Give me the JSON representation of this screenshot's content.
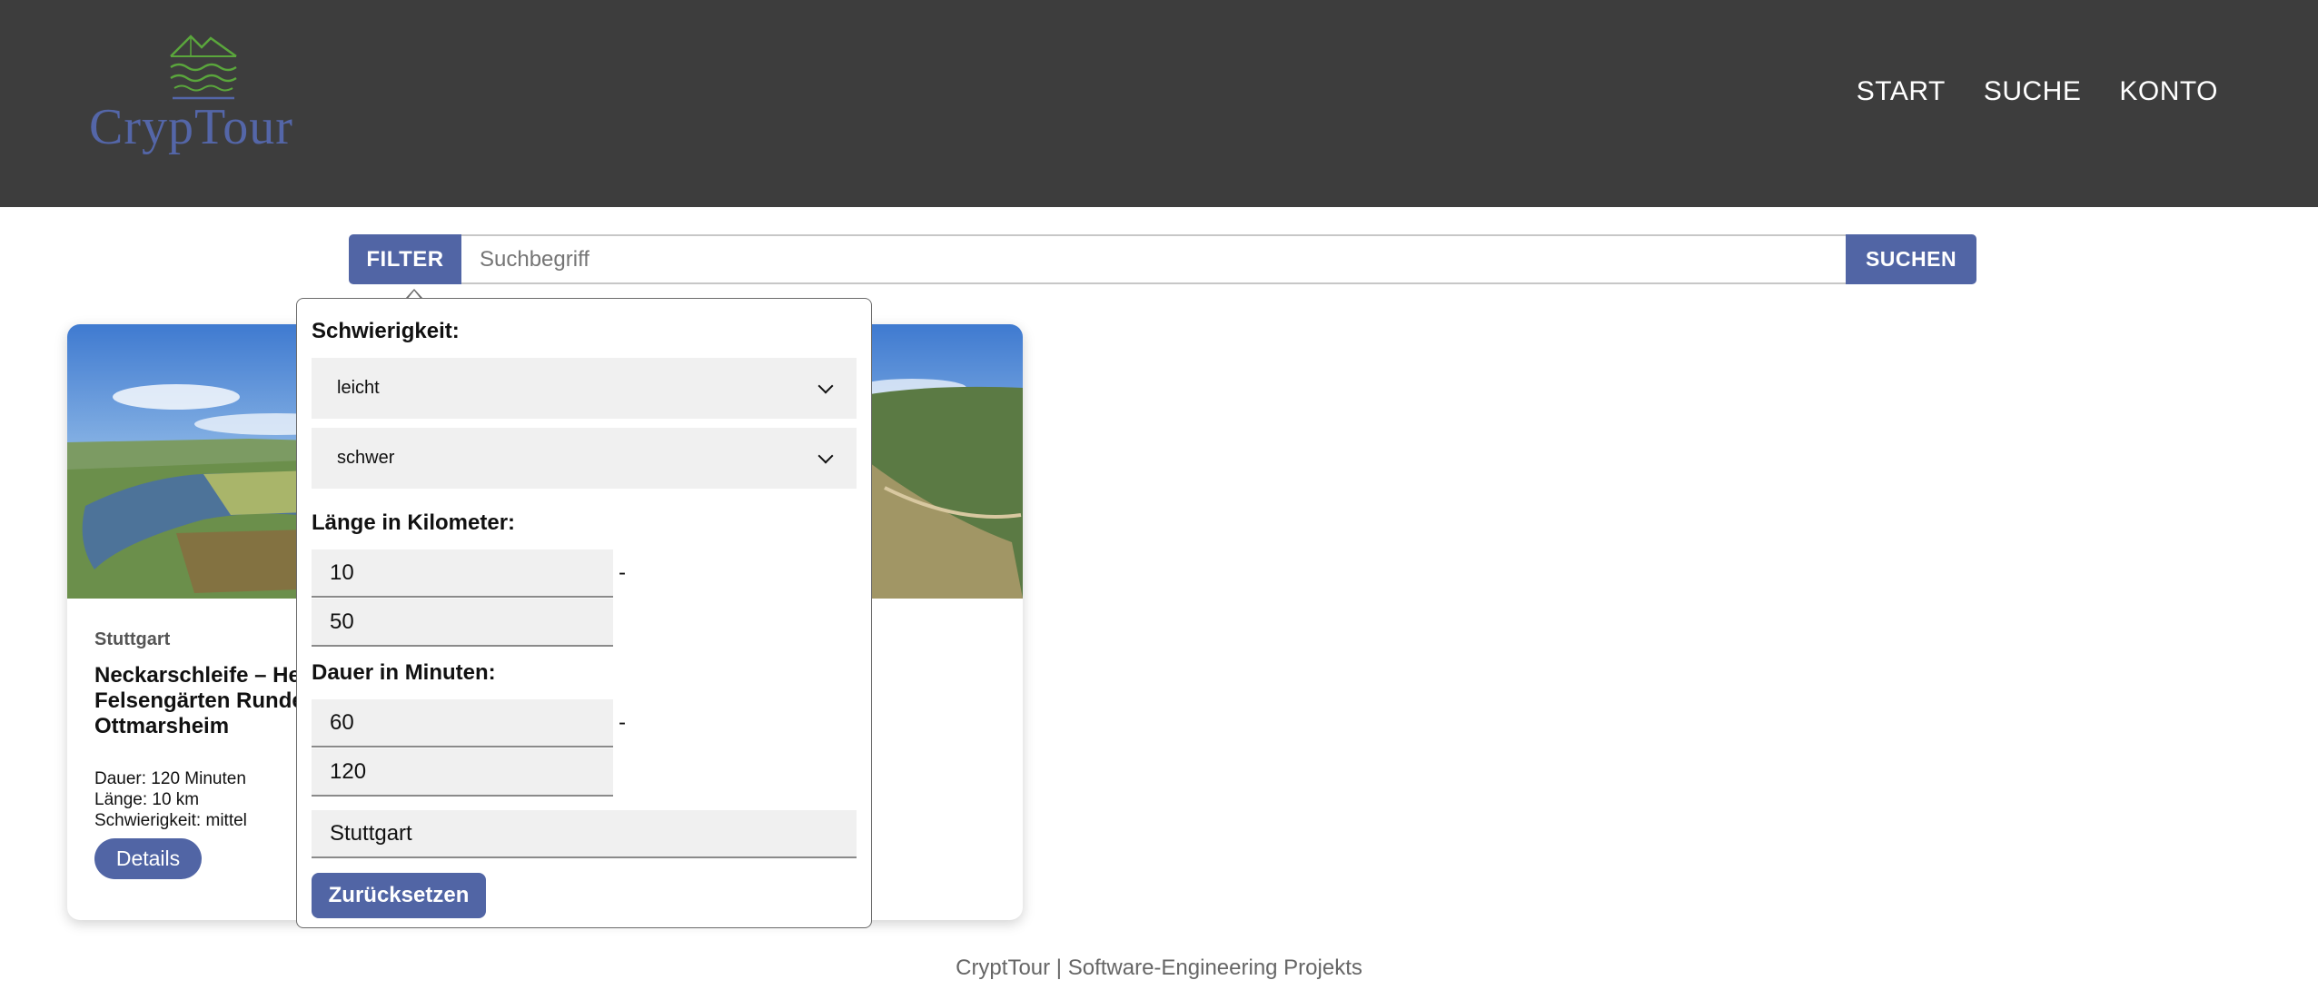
{
  "header": {
    "logo_text": "CrypTour",
    "nav": [
      "START",
      "SUCHE",
      "KONTO"
    ]
  },
  "search": {
    "filter_label": "FILTER",
    "placeholder": "Suchbegriff",
    "button_label": "SUCHEN"
  },
  "tour_card": {
    "location": "Stuttgart",
    "title": "Neckarschleife – He Felsengärten Runde Ottmarsheim",
    "duration": "Dauer: 120 Minuten",
    "length": "Länge: 10 km",
    "difficulty": "Schwierigkeit: mittel",
    "details_label": "Details"
  },
  "filter": {
    "difficulty_label": "Schwierigkeit:",
    "difficulty_min": "leicht",
    "difficulty_max": "schwer",
    "length_label": "Länge in Kilometer:",
    "length_min": "10",
    "length_max": "50",
    "duration_label": "Dauer in Minuten:",
    "duration_min": "60",
    "duration_max": "120",
    "range_separator": "-",
    "city": "Stuttgart",
    "reset_label": "Zurücksetzen"
  },
  "footer": {
    "text": "CryptTour | Software-Engineering Projekts"
  },
  "colors": {
    "header_bg": "#3d3d3d",
    "accent": "#5165a5",
    "logo_blue": "#5466a8",
    "logo_green": "#5aa63c"
  }
}
